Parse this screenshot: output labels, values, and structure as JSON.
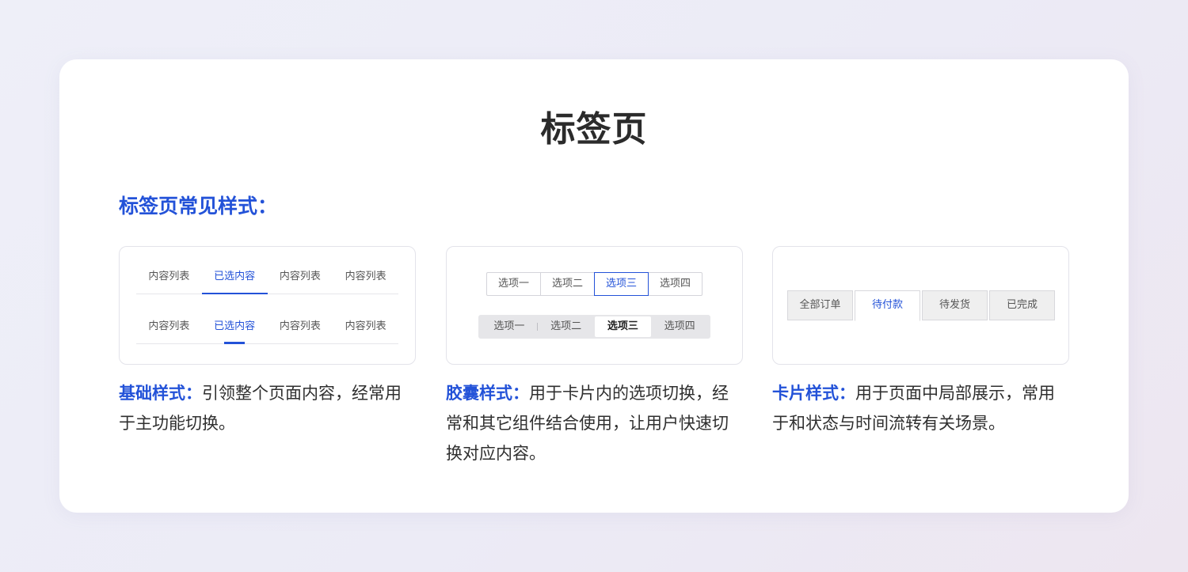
{
  "title": "标签页",
  "subtitle": "标签页常见样式：",
  "basic": {
    "row1": [
      "内容列表",
      "已选内容",
      "内容列表",
      "内容列表"
    ],
    "row2": [
      "内容列表",
      "已选内容",
      "内容列表",
      "内容列表"
    ],
    "active_index": 1
  },
  "capsule": {
    "outline": [
      "选项一",
      "选项二",
      "选项三",
      "选项四"
    ],
    "filled": [
      "选项一",
      "选项二",
      "选项三",
      "选项四"
    ],
    "active_index": 2
  },
  "cards": {
    "tabs": [
      "全部订单",
      "待付款",
      "待发货",
      "已完成"
    ],
    "active_index": 1
  },
  "descriptions": {
    "basic": {
      "lead": "基础样式：",
      "text": "引领整个页面内容，经常用于主功能切换。"
    },
    "capsule": {
      "lead": "胶囊样式：",
      "text": "用于卡片内的选项切换，经常和其它组件结合使用，让用户快速切换对应内容。"
    },
    "card": {
      "lead": "卡片样式：",
      "text": "用于页面中局部展示，常用于和状态与时间流转有关场景。"
    }
  },
  "colors": {
    "accent": "#2352d8",
    "text": "#2f2f2f",
    "background": "#eeeff8"
  }
}
